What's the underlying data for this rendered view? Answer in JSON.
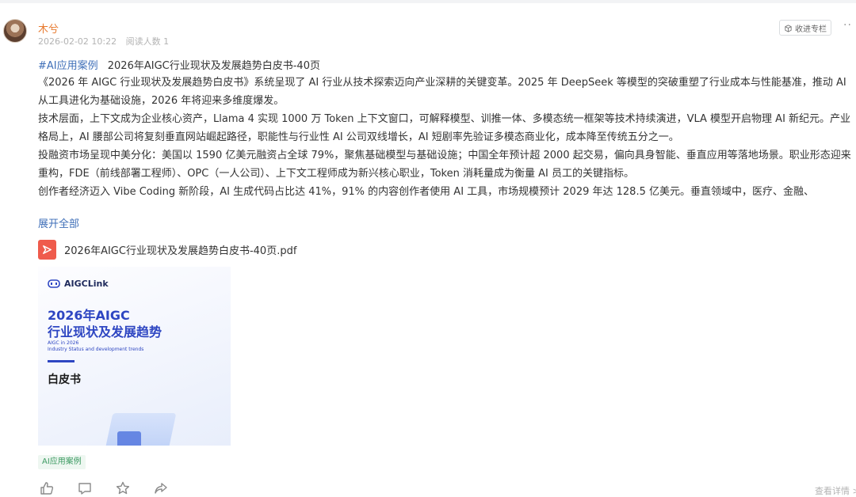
{
  "post": {
    "author": "木兮",
    "date": "2026-02-02 10:22",
    "read_count": "阅读人数 1",
    "collect_label": "收进专栏",
    "more": "··",
    "hashtag": "#AI应用案例",
    "title": "2026年AIGC行业现状及发展趋势白皮书-40页",
    "paragraphs": [
      "《2026 年 AIGC 行业现状及发展趋势白皮书》系统呈现了 AI 行业从技术探索迈向产业深耕的关键变革。2025 年 DeepSeek 等模型的突破重塑了行业成本与性能基准，推动 AI 从工具进化为基础设施，2026 年将迎来多维度爆发。",
      "技术层面，上下文成为企业核心资产，Llama 4 实现 1000 万 Token 上下文窗口，可解释模型、训推一体、多模态统一框架等技术持续演进，VLA 模型开启物理 AI 新纪元。产业格局上，AI 腰部公司将复刻垂直网站崛起路径，职能性与行业性 AI 公司双线增长，AI 短剧率先验证多模态商业化，成本降至传统五分之一。",
      "投融资市场呈现中美分化：美国以 1590 亿美元融资占全球 79%，聚焦基础模型与基础设施；中国全年预计超 2000 起交易，偏向具身智能、垂直应用等落地场景。职业形态迎来重构，FDE（前线部署工程师）、OPC（一人公司）、上下文工程师成为新兴核心职业，Token 消耗量成为衡量 AI 员工的关键指标。",
      "创作者经济迈入 Vibe Coding 新阶段，AI 生成代码占比达 41%，91% 的内容创作者使用 AI 工具，市场规模预计 2029 年达 128.5 亿美元。垂直领域中，医疗、金融、"
    ],
    "expand_label": "展开全部",
    "attachment_name": "2026年AIGC行业现状及发展趋势白皮书-40页.pdf",
    "cover": {
      "logo": "AIGCLink",
      "title_line1": "2026年AIGC",
      "title_line2": "行业现状及发展趋势",
      "en_line1": "AIGC in 2026",
      "en_line2": "Industry  Status and development trends",
      "subtitle": "白皮书"
    },
    "topic_tag": "AI应用案例",
    "view_detail": "查看详情 >"
  },
  "colors": {
    "author": "#e87a2f",
    "link": "#3f6fb8",
    "tag_bg": "#eef7f1",
    "tag_text": "#3e9b63",
    "pdf_red": "#ef5b4c",
    "cover_blue": "#2e46c2"
  },
  "icons": [
    "collect-icon",
    "pdf-icon",
    "like-icon",
    "comment-icon",
    "star-icon",
    "share-icon"
  ]
}
